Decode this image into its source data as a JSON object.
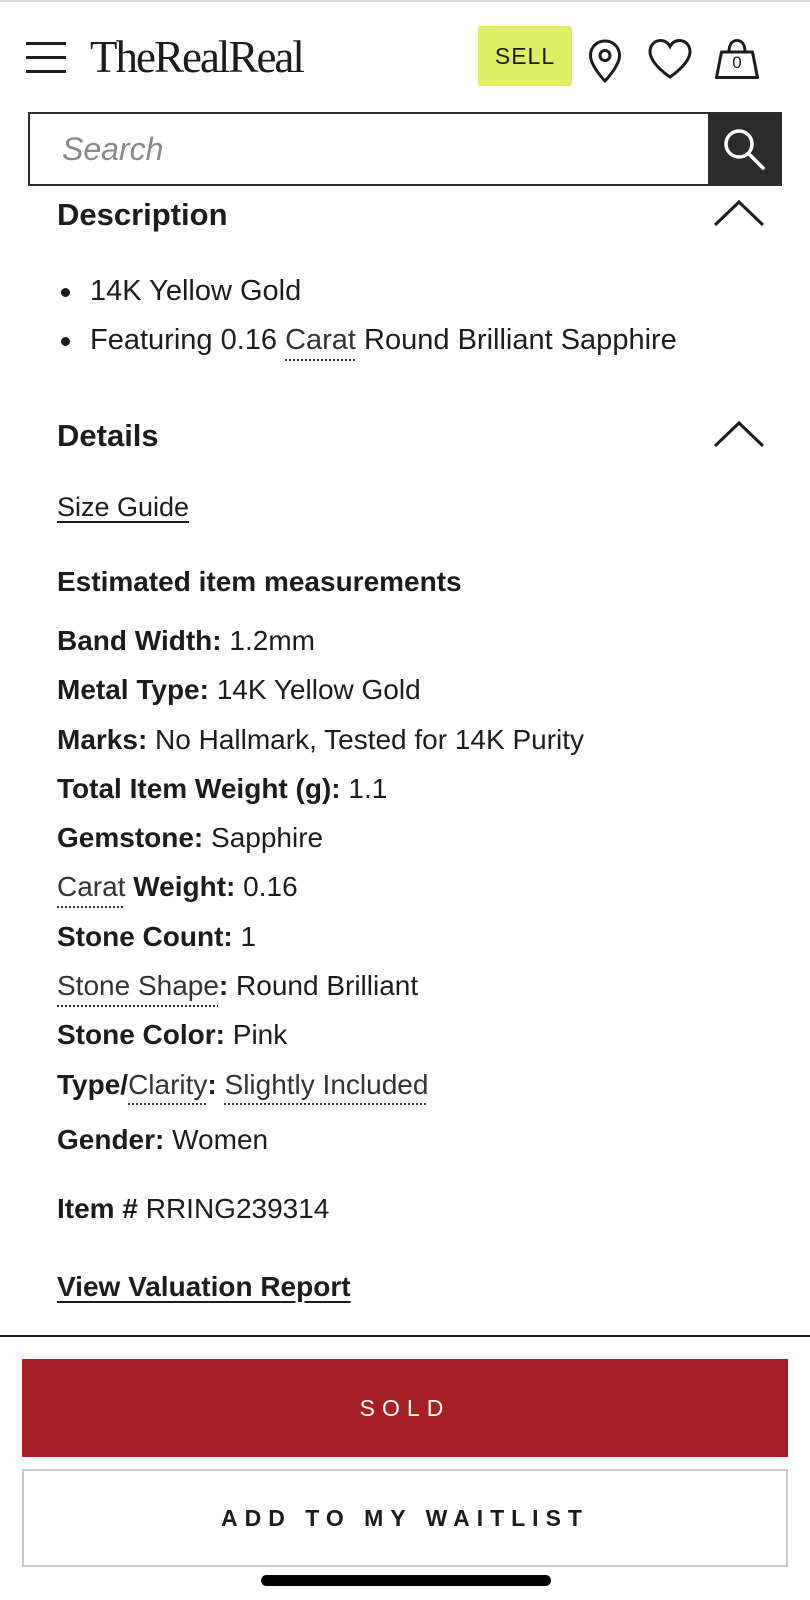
{
  "header": {
    "logo": "TheRealReal",
    "sell_label": "SELL",
    "cart_count": "0",
    "accent_color": "#dcef62"
  },
  "search": {
    "placeholder": "Search"
  },
  "description": {
    "title": "Description",
    "bullets": [
      "14K Yellow Gold",
      {
        "before": "Featuring 0.16 ",
        "gloss": "Carat",
        "after": " Round Brilliant Sapphire"
      }
    ]
  },
  "details": {
    "title": "Details",
    "size_guide": "Size Guide",
    "measurements_heading": "Estimated item measurements",
    "specs": {
      "band_width": {
        "label": "Band Width:",
        "value": " 1.2mm"
      },
      "metal_type": {
        "label": "Metal Type:",
        "value": " 14K Yellow Gold"
      },
      "marks": {
        "label": "Marks:",
        "value": " No Hallmark, Tested for 14K Purity"
      },
      "total_weight": {
        "label": "Total Item Weight (g):",
        "value": " 1.1"
      },
      "gemstone": {
        "label": "Gemstone:",
        "value": " Sapphire"
      },
      "carat_weight": {
        "gloss": "Carat",
        "label": " Weight:",
        "value": " 0.16"
      },
      "stone_count": {
        "label": "Stone Count:",
        "value": " 1"
      },
      "stone_shape": {
        "gloss": "Stone Shape",
        "label": ":",
        "value": " Round Brilliant"
      },
      "stone_color": {
        "label": "Stone Color:",
        "value": " Pink"
      },
      "clarity": {
        "label_prefix": "Type/",
        "gloss": "Clarity",
        "label_suffix": ":",
        "value_gloss": "Slightly Included"
      }
    },
    "gender": {
      "label": "Gender:",
      "value": " Women"
    },
    "item_number": {
      "label": "Item #",
      "value": " RRING239314"
    },
    "valuation_link": "View Valuation Report"
  },
  "actions": {
    "sold_label": "SOLD",
    "waitlist_label": "ADD TO MY WAITLIST",
    "sold_color": "#a51f24"
  }
}
